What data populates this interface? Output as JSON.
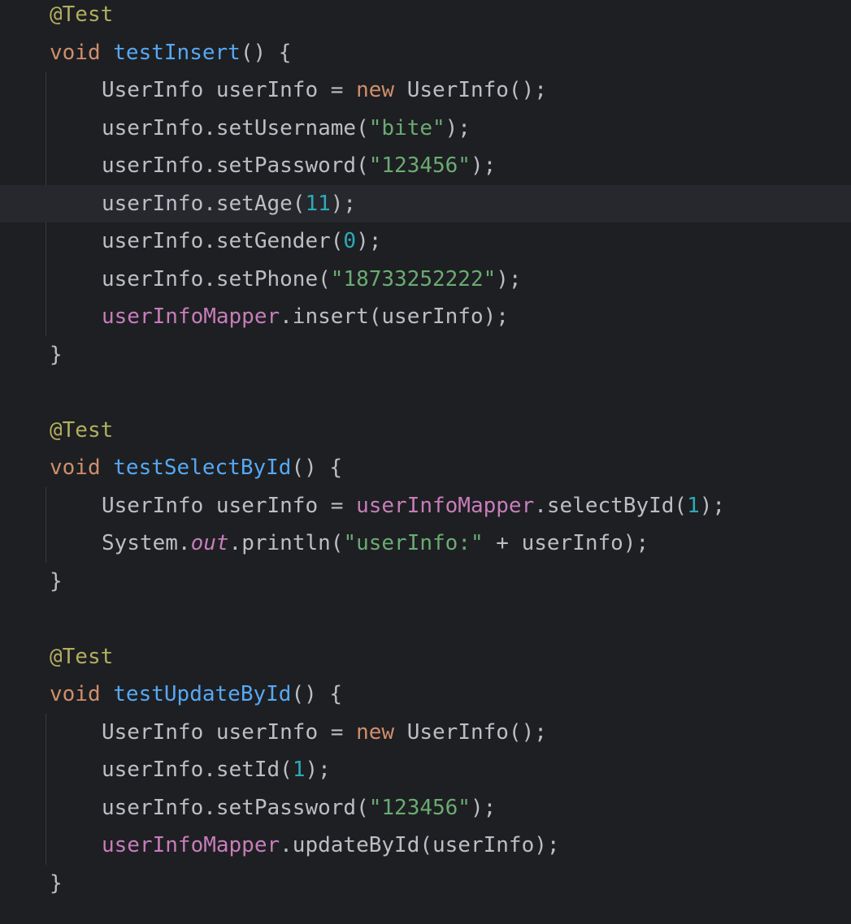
{
  "editor": {
    "current_line": 5,
    "lines": [
      {
        "indent": 1,
        "tokens": [
          [
            "annotation",
            "@Test"
          ]
        ]
      },
      {
        "indent": 1,
        "tokens": [
          [
            "keyword",
            "void "
          ],
          [
            "method",
            "testInsert"
          ],
          [
            "plain",
            "() {"
          ]
        ]
      },
      {
        "indent": 2,
        "tokens": [
          [
            "plain",
            "UserInfo userInfo = "
          ],
          [
            "keyword",
            "new "
          ],
          [
            "plain",
            "UserInfo();"
          ]
        ]
      },
      {
        "indent": 2,
        "tokens": [
          [
            "plain",
            "userInfo.setUsername("
          ],
          [
            "string",
            "\"bite\""
          ],
          [
            "plain",
            ");"
          ]
        ]
      },
      {
        "indent": 2,
        "tokens": [
          [
            "plain",
            "userInfo.setPassword("
          ],
          [
            "string",
            "\"123456\""
          ],
          [
            "plain",
            ");"
          ]
        ]
      },
      {
        "indent": 2,
        "tokens": [
          [
            "plain",
            "userInfo.setAge("
          ],
          [
            "number",
            "11"
          ],
          [
            "plain",
            ");"
          ]
        ]
      },
      {
        "indent": 2,
        "tokens": [
          [
            "plain",
            "userInfo.setGender("
          ],
          [
            "number",
            "0"
          ],
          [
            "plain",
            ");"
          ]
        ]
      },
      {
        "indent": 2,
        "tokens": [
          [
            "plain",
            "userInfo.setPhone("
          ],
          [
            "string",
            "\"18733252222\""
          ],
          [
            "plain",
            ");"
          ]
        ]
      },
      {
        "indent": 2,
        "tokens": [
          [
            "field",
            "userInfoMapper"
          ],
          [
            "plain",
            ".insert(userInfo);"
          ]
        ]
      },
      {
        "indent": 1,
        "tokens": [
          [
            "plain",
            "}"
          ]
        ]
      },
      {
        "indent": 0,
        "tokens": []
      },
      {
        "indent": 1,
        "tokens": [
          [
            "annotation",
            "@Test"
          ]
        ]
      },
      {
        "indent": 1,
        "tokens": [
          [
            "keyword",
            "void "
          ],
          [
            "method",
            "testSelectById"
          ],
          [
            "plain",
            "() {"
          ]
        ]
      },
      {
        "indent": 2,
        "tokens": [
          [
            "plain",
            "UserInfo userInfo = "
          ],
          [
            "field",
            "userInfoMapper"
          ],
          [
            "plain",
            ".selectById("
          ],
          [
            "number",
            "1"
          ],
          [
            "plain",
            ");"
          ]
        ]
      },
      {
        "indent": 2,
        "tokens": [
          [
            "plain",
            "System."
          ],
          [
            "static",
            "out"
          ],
          [
            "plain",
            ".println("
          ],
          [
            "string",
            "\"userInfo:\""
          ],
          [
            "plain",
            " + userInfo);"
          ]
        ]
      },
      {
        "indent": 1,
        "tokens": [
          [
            "plain",
            "}"
          ]
        ]
      },
      {
        "indent": 0,
        "tokens": []
      },
      {
        "indent": 1,
        "tokens": [
          [
            "annotation",
            "@Test"
          ]
        ]
      },
      {
        "indent": 1,
        "tokens": [
          [
            "keyword",
            "void "
          ],
          [
            "method",
            "testUpdateById"
          ],
          [
            "plain",
            "() {"
          ]
        ]
      },
      {
        "indent": 2,
        "tokens": [
          [
            "plain",
            "UserInfo userInfo = "
          ],
          [
            "keyword",
            "new "
          ],
          [
            "plain",
            "UserInfo();"
          ]
        ]
      },
      {
        "indent": 2,
        "tokens": [
          [
            "plain",
            "userInfo.setId("
          ],
          [
            "number",
            "1"
          ],
          [
            "plain",
            ");"
          ]
        ]
      },
      {
        "indent": 2,
        "tokens": [
          [
            "plain",
            "userInfo.setPassword("
          ],
          [
            "string",
            "\"123456\""
          ],
          [
            "plain",
            ");"
          ]
        ]
      },
      {
        "indent": 2,
        "tokens": [
          [
            "field",
            "userInfoMapper"
          ],
          [
            "plain",
            ".updateById(userInfo);"
          ]
        ]
      },
      {
        "indent": 1,
        "tokens": [
          [
            "plain",
            "}"
          ]
        ]
      }
    ]
  }
}
